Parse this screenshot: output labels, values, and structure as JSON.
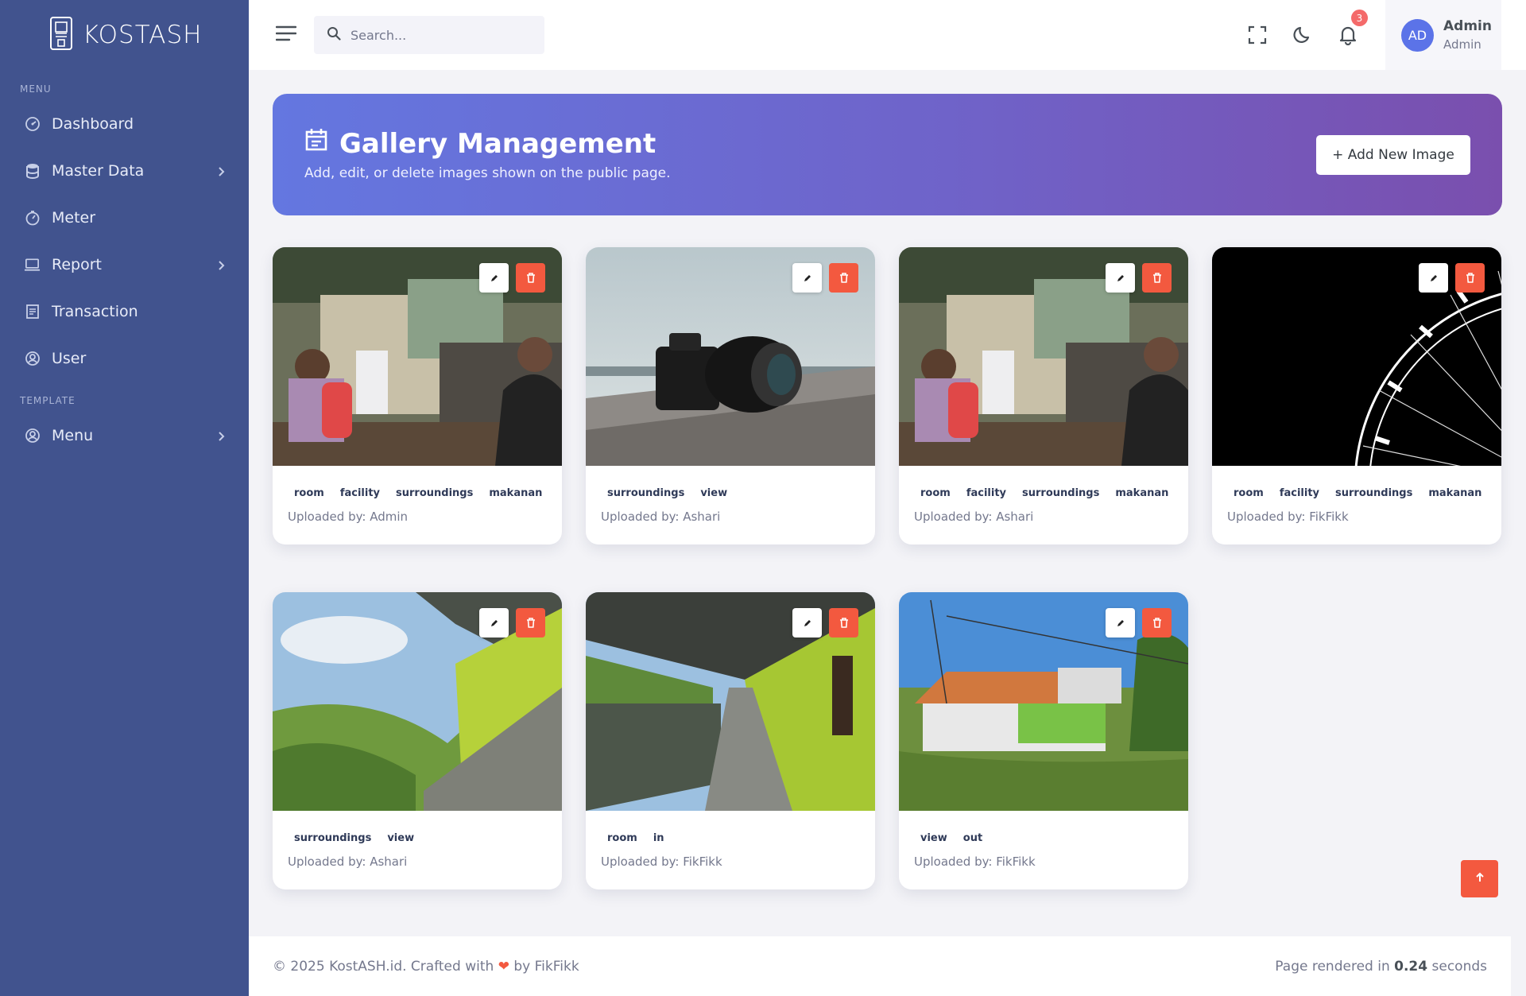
{
  "brand": {
    "name": "KOSTASH"
  },
  "sidebar": {
    "sections": [
      {
        "title": "MENU"
      },
      {
        "title": "TEMPLATE"
      }
    ],
    "items": [
      {
        "label": "Dashboard",
        "icon": "dashboard-icon"
      },
      {
        "label": "Master Data",
        "icon": "database-icon",
        "has_children": true
      },
      {
        "label": "Meter",
        "icon": "meter-icon"
      },
      {
        "label": "Report",
        "icon": "laptop-icon",
        "has_children": true
      },
      {
        "label": "Transaction",
        "icon": "receipt-icon"
      },
      {
        "label": "User",
        "icon": "user-circle-icon"
      },
      {
        "label": "Menu",
        "icon": "user-circle-icon",
        "has_children": true
      }
    ]
  },
  "topbar": {
    "search_placeholder": "Search...",
    "notification_count": "3",
    "user": {
      "initials": "AD",
      "name": "Admin",
      "role": "Admin"
    }
  },
  "banner": {
    "title": "Gallery Management",
    "subtitle": "Add, edit, or delete images shown on the public page.",
    "add_button": "+ Add New Image"
  },
  "gallery": [
    {
      "tags": [
        "room",
        "facility",
        "surroundings",
        "makanan"
      ],
      "uploader": "Uploaded by: Admin"
    },
    {
      "tags": [
        "surroundings",
        "view"
      ],
      "uploader": "Uploaded by: Ashari"
    },
    {
      "tags": [
        "room",
        "facility",
        "surroundings",
        "makanan"
      ],
      "uploader": "Uploaded by: Ashari"
    },
    {
      "tags": [
        "room",
        "facility",
        "surroundings",
        "makanan"
      ],
      "uploader": "Uploaded by: FikFikk"
    },
    {
      "tags": [
        "surroundings",
        "view"
      ],
      "uploader": "Uploaded by: Ashari"
    },
    {
      "tags": [
        "room",
        "in"
      ],
      "uploader": "Uploaded by: FikFikk"
    },
    {
      "tags": [
        "view",
        "out"
      ],
      "uploader": "Uploaded by: FikFikk"
    }
  ],
  "footer": {
    "left_prefix": "© 2025 KostASH.id. Crafted with",
    "left_suffix": "by FikFikk",
    "right_prefix": "Page rendered in",
    "render_time": "0.24",
    "right_suffix": "seconds"
  },
  "colors": {
    "sidebar": "#41538e",
    "accent_red": "#f3593f",
    "avatar": "#5b73e8",
    "banner_start": "#6477e0",
    "banner_end": "#7a4fae"
  }
}
